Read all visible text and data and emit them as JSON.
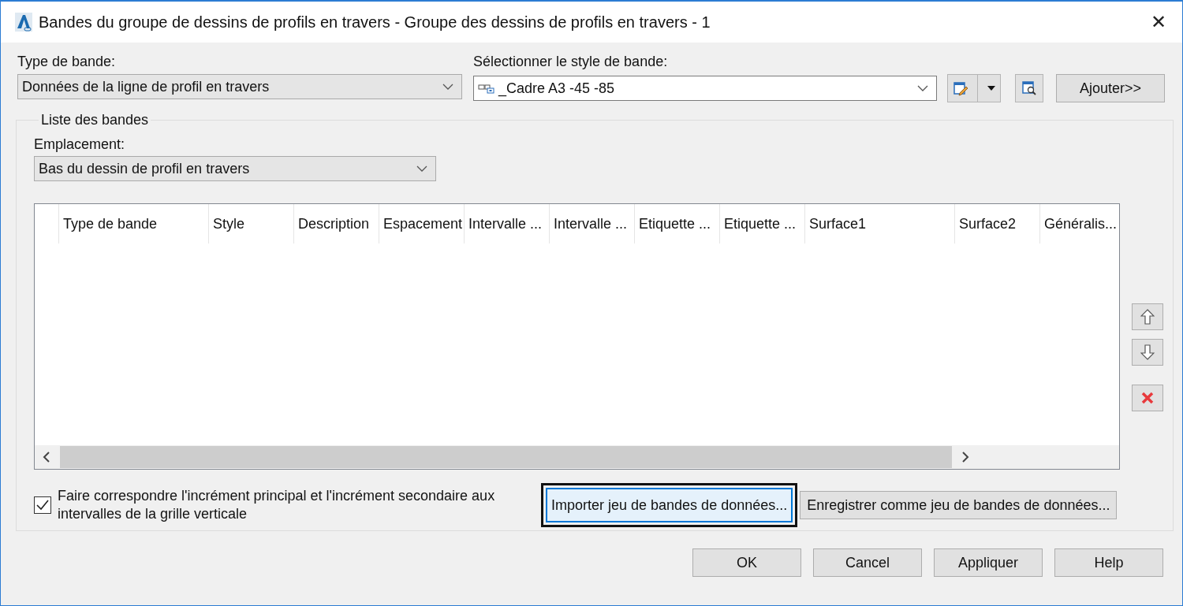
{
  "window": {
    "title": "Bandes du groupe de dessins de profils en travers - Groupe des dessins de profils en travers - 1",
    "close": "✕"
  },
  "band_type": {
    "label": "Type de bande:",
    "value": "Données de la ligne de profil en travers"
  },
  "band_style": {
    "label": "Sélectionner le style de bande:",
    "value": "_Cadre A3 -45 -85"
  },
  "add_button": "Ajouter>>",
  "band_list": {
    "title": "Liste des bandes",
    "location": {
      "label": "Emplacement:",
      "value": "Bas du dessin de profil en travers"
    },
    "table": {
      "columns": [
        "Type de bande",
        "Style",
        "Description",
        "Espacement",
        "Intervalle ...",
        "Intervalle ...",
        "Etiquette ...",
        "Etiquette ...",
        "Surface1",
        "Surface2",
        "Généralis..."
      ]
    },
    "match_grid": {
      "label": "Faire correspondre l'incrément principal et l'incrément secondaire aux intervalles de la grille verticale",
      "checked": true
    },
    "actions": [
      {
        "label": "Importer jeu de bandes de données...",
        "focused": true
      },
      {
        "label": "Enregistrer comme jeu de bandes de données...",
        "focused": false
      }
    ]
  },
  "buttons": [
    "OK",
    "Cancel",
    "Appliquer",
    "Help"
  ]
}
